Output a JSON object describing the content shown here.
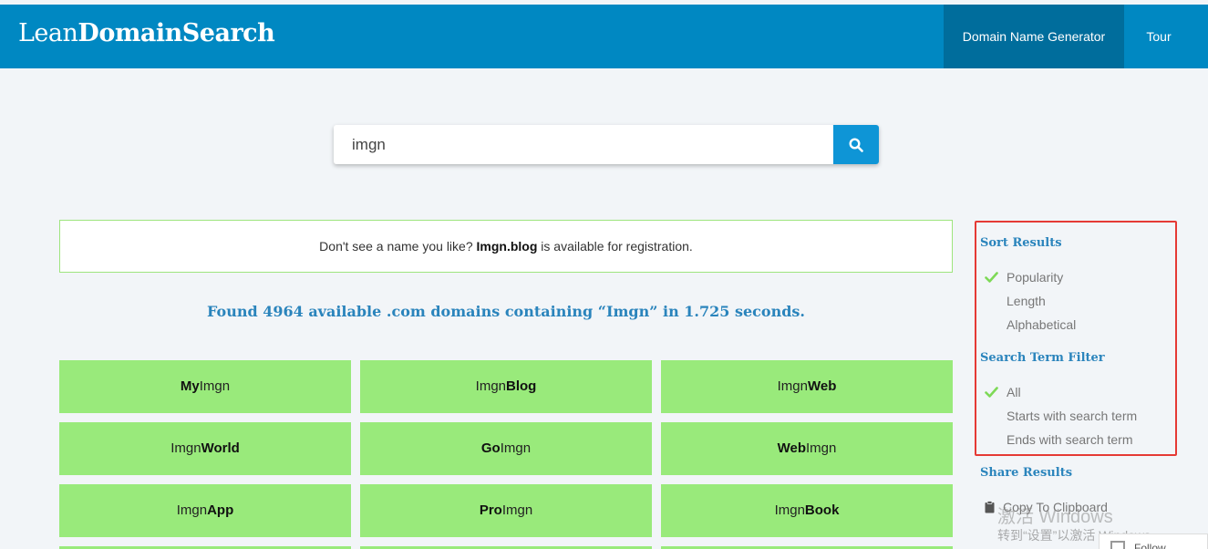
{
  "header": {
    "logo_light": "Lean",
    "logo_bold": "DomainSearch",
    "nav": [
      {
        "label": "Domain Name Generator"
      },
      {
        "label": "Tour"
      }
    ]
  },
  "search": {
    "value": "imgn",
    "button_icon": "search-icon"
  },
  "notice": {
    "prefix": "Don't see a name you like? ",
    "domain": "Imgn.blog",
    "suffix": " is available for registration."
  },
  "results": {
    "summary": "Found 4964 available .com domains containing “Imgn” in 1.725 seconds.",
    "tiles": [
      {
        "pre": "My",
        "base": "Imgn",
        "post": ""
      },
      {
        "pre": "",
        "base": "Imgn",
        "post": "Blog"
      },
      {
        "pre": "",
        "base": "Imgn",
        "post": "Web"
      },
      {
        "pre": "",
        "base": "Imgn",
        "post": "World"
      },
      {
        "pre": "Go",
        "base": "Imgn",
        "post": ""
      },
      {
        "pre": "Web",
        "base": "Imgn",
        "post": ""
      },
      {
        "pre": "",
        "base": "Imgn",
        "post": "App"
      },
      {
        "pre": "Pro",
        "base": "Imgn",
        "post": ""
      },
      {
        "pre": "",
        "base": "Imgn",
        "post": "Book"
      }
    ]
  },
  "sidebar": {
    "sort": {
      "heading": "Sort Results",
      "options": [
        {
          "label": "Popularity",
          "selected": true
        },
        {
          "label": "Length",
          "selected": false
        },
        {
          "label": "Alphabetical",
          "selected": false
        }
      ]
    },
    "filter": {
      "heading": "Search Term Filter",
      "options": [
        {
          "label": "All",
          "selected": true
        },
        {
          "label": "Starts with search term",
          "selected": false
        },
        {
          "label": "Ends with search term",
          "selected": false
        }
      ]
    },
    "share": {
      "heading": "Share Results",
      "copy_label": "Copy To Clipboard"
    }
  },
  "watermark": {
    "line1": "激活 Windows",
    "line2": "转到“设置”以激活 Windows。"
  },
  "follow_label": "Follow",
  "colors": {
    "header": "#0088c2",
    "tile": "#99ea7b",
    "accent": "#2a84bc",
    "check": "#7ed957",
    "highlight": "#e53a35"
  }
}
